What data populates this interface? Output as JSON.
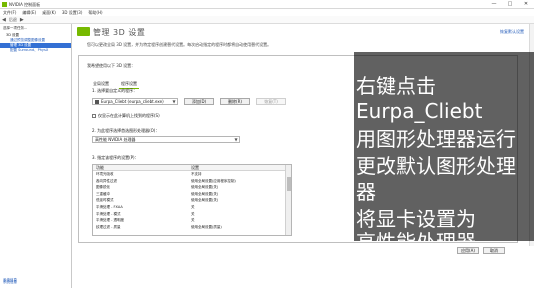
{
  "window": {
    "title": "NVIDIA 控制面板",
    "controls": [
      "—",
      "□",
      "✕"
    ]
  },
  "menu": [
    "文件(F)",
    "编辑(E)",
    "桌面(K)",
    "3D 设置(3)",
    "帮助(H)"
  ],
  "toolbar": {
    "back": "◀",
    "forward": "▶",
    "home_label": "后退"
  },
  "sidebar": {
    "heading": "选择一项任务...",
    "items": [
      {
        "label": "3D 设置",
        "selected": false
      },
      {
        "label": "通过预览调整图像设置",
        "selected": false
      },
      {
        "label": "管理 3D 设置",
        "selected": true
      },
      {
        "label": "配置 Surround、PhysX",
        "selected": false
      }
    ],
    "footer": "系统信息"
  },
  "header": {
    "title": "管理 3D 设置",
    "restore": "恢复默认设置",
    "description": "您可以更改全局 3D 设置，并为特定程序创建替代设置。每次启动指定的程序时都将自动使用替代设置。"
  },
  "panel": {
    "label": "我希望使用以下 3D 设置：",
    "tabs": [
      "全局设置",
      "程序设置"
    ],
    "section1": "1. 选择要自定义的程序：",
    "program_value": "Eurpa_Cliebt (eurpa_cliebt.exe)",
    "add_button": "添加(D)",
    "remove_button": "删除(R)",
    "restore_button": "恢复(T)",
    "checkbox": "仅显示在此计算机上找到的程序(S)",
    "section2": "2. 为此程序选择首选图形处理器(O)：",
    "gpu_value": "高性能 NVIDIA 处理器",
    "section3": "3. 指定该程序的设置(P)：",
    "table_headers": [
      "功能",
      "设置"
    ],
    "table_rows": [
      [
        "环境光吸收",
        "不支持"
      ],
      [
        "各向异性过滤",
        "使用全局设置(应用程序控制)"
      ],
      [
        "图像锐化",
        "使用全局设置(关)"
      ],
      [
        "三重缓冲",
        "使用全局设置(关)"
      ],
      [
        "低延时模式",
        "使用全局设置(关)"
      ],
      [
        "平滑处理 - FXAA",
        "关"
      ],
      [
        "平滑处理 - 模式",
        "关"
      ],
      [
        "平滑处理 - 透明度",
        "关"
      ],
      [
        "纹理过滤 - 质量",
        "使用全局设置(质量)"
      ]
    ]
  },
  "footer_buttons": {
    "apply": "应用(A)",
    "cancel": "取消"
  },
  "overlay_text": [
    "右键点击",
    "Eurpa_Cliebt",
    "用图形处理器运行",
    "更改默认图形处理",
    "器",
    "将显卡设置为",
    "高性能处理器"
  ]
}
